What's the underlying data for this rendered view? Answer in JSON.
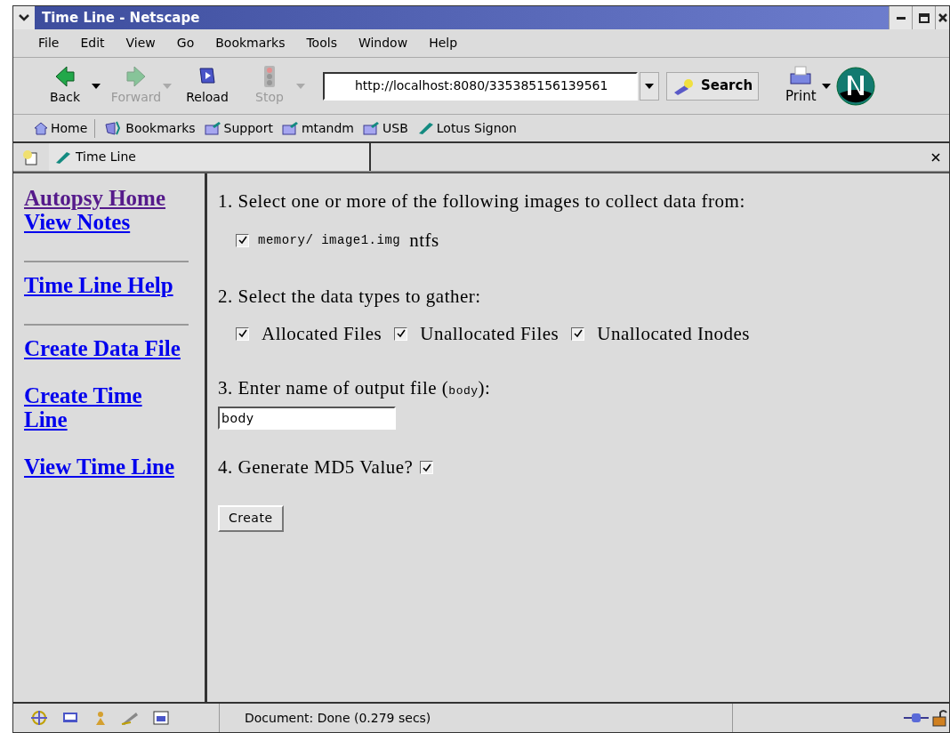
{
  "window": {
    "title": "Time Line - Netscape"
  },
  "menu": [
    {
      "label": "File"
    },
    {
      "label": "Edit"
    },
    {
      "label": "View"
    },
    {
      "label": "Go"
    },
    {
      "label": "Bookmarks"
    },
    {
      "label": "Tools"
    },
    {
      "label": "Window"
    },
    {
      "label": "Help"
    }
  ],
  "toolbar": {
    "buttons": [
      {
        "kind": "back",
        "label": "Back",
        "disabled": false,
        "dropdown": true
      },
      {
        "kind": "forward",
        "label": "Forward",
        "disabled": true,
        "dropdown": true
      },
      {
        "kind": "reload",
        "label": "Reload",
        "disabled": false,
        "dropdown": false
      },
      {
        "kind": "stop",
        "label": "Stop",
        "disabled": true,
        "dropdown": true
      }
    ],
    "url": "http://localhost:8080/335385156139561",
    "search": "Search",
    "print": "Print"
  },
  "bookmarks": [
    {
      "kind": "home",
      "label": "Home"
    },
    {
      "kind": "bookmarks",
      "label": "Bookmarks"
    },
    {
      "kind": "folder",
      "label": "Support"
    },
    {
      "kind": "folder",
      "label": "mtandm"
    },
    {
      "kind": "folder",
      "label": "USB"
    },
    {
      "kind": "page",
      "label": "Lotus Signon"
    }
  ],
  "tab": {
    "label": "Time Line"
  },
  "sidebar": {
    "groups": [
      [
        {
          "label": "Autopsy Home",
          "visited": true
        },
        {
          "label": "View Notes",
          "visited": false
        }
      ],
      [
        {
          "label": "Time Line Help",
          "visited": false
        }
      ],
      [
        {
          "label": "Create Data File",
          "visited": false
        },
        {
          "label": "Create Time Line",
          "visited": false
        },
        {
          "label": "View Time Line",
          "visited": false
        }
      ]
    ]
  },
  "form": {
    "step1": "1. Select one or more of the following images to collect data from:",
    "images": [
      {
        "path": "memory/ image1.img",
        "fs": "ntfs",
        "checked": true
      }
    ],
    "step2": "2. Select the data types to gather:",
    "types": [
      {
        "label": "Allocated Files",
        "checked": true
      },
      {
        "label": "Unallocated Files",
        "checked": true
      },
      {
        "label": "Unallocated Inodes",
        "checked": true
      }
    ],
    "step3_prefix": "3. Enter name of output file (",
    "step3_code": "body",
    "step3_suffix": "):",
    "output_value": "body",
    "step4": "4. Generate MD5 Value?",
    "md5_checked": true,
    "submit": "Create"
  },
  "status_bar": {
    "text": "Document: Done (0.279 secs)"
  }
}
